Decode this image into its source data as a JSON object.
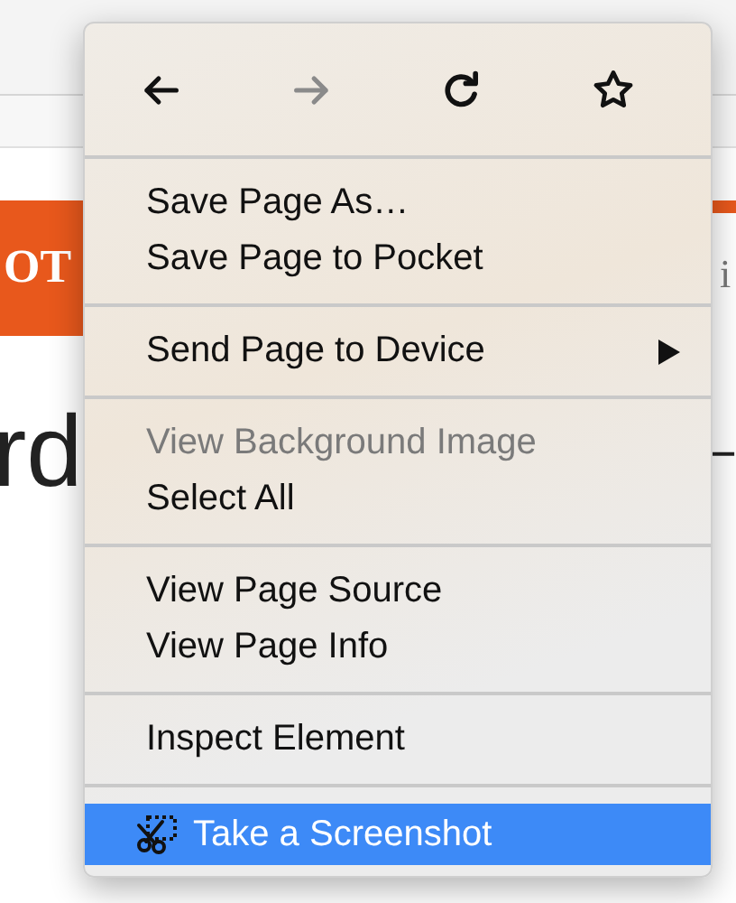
{
  "page": {
    "banner_text": "OT",
    "side_text": "i",
    "heading_text": "rd",
    "side_dash": "–"
  },
  "context_menu": {
    "nav_buttons": [
      {
        "kind": "back",
        "disabled": false
      },
      {
        "kind": "forward",
        "disabled": true
      },
      {
        "kind": "reload",
        "disabled": false
      },
      {
        "kind": "bookmark",
        "disabled": false
      }
    ],
    "sections": [
      {
        "items": [
          {
            "label": "Save Page As…",
            "disabled": false,
            "selected": false,
            "submenu": false,
            "icon": false
          },
          {
            "label": "Save Page to Pocket",
            "disabled": false,
            "selected": false,
            "submenu": false,
            "icon": false
          }
        ]
      },
      {
        "items": [
          {
            "label": "Send Page to Device",
            "disabled": false,
            "selected": false,
            "submenu": true,
            "icon": false
          }
        ]
      },
      {
        "items": [
          {
            "label": "View Background Image",
            "disabled": true,
            "selected": false,
            "submenu": false,
            "icon": false
          },
          {
            "label": "Select All",
            "disabled": false,
            "selected": false,
            "submenu": false,
            "icon": false
          }
        ]
      },
      {
        "items": [
          {
            "label": "View Page Source",
            "disabled": false,
            "selected": false,
            "submenu": false,
            "icon": false
          },
          {
            "label": "View Page Info",
            "disabled": false,
            "selected": false,
            "submenu": false,
            "icon": false
          }
        ]
      },
      {
        "items": [
          {
            "label": "Inspect Element",
            "disabled": false,
            "selected": false,
            "submenu": false,
            "icon": false
          }
        ]
      },
      {
        "items": [
          {
            "label": "Take a Screenshot",
            "disabled": false,
            "selected": true,
            "submenu": false,
            "icon": true
          }
        ]
      }
    ]
  }
}
